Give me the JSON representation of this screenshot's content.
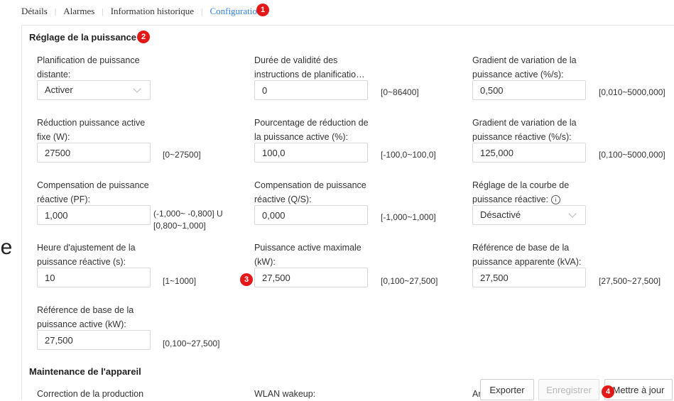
{
  "tabs": [
    "Détails",
    "Alarmes",
    "Information historique",
    "Configuration"
  ],
  "badges": [
    "1",
    "2",
    "3",
    "4"
  ],
  "left_clip_text": "le",
  "power_section": {
    "title": "Réglage de la puissance",
    "fields": [
      {
        "label": "Planification de puissance distante:",
        "value": "Activer",
        "type": "select",
        "range": ""
      },
      {
        "label": "Durée de validité des instructions de planificatio…",
        "value": "0",
        "type": "input",
        "range": "[0~86400]"
      },
      {
        "label": "Gradient de variation de la puissance active (%/s):",
        "value": "0,500",
        "type": "input",
        "range": "[0,010~5000,000]"
      },
      {
        "label": "Réduction puissance active fixe (W):",
        "value": "27500",
        "type": "input",
        "range": "[0~27500]"
      },
      {
        "label": "Pourcentage de réduction de la puissance active (%):",
        "value": "100,0",
        "type": "input",
        "range": "[-100,0~100,0]"
      },
      {
        "label": "Gradient de variation de la puissance réactive (%/s):",
        "value": "125,000",
        "type": "input",
        "range": "[0,100~5000,000]"
      },
      {
        "label": "Compensation de puissance réactive (PF):",
        "value": "1,000",
        "type": "input",
        "range": "(-1,000~ -0,800] U [0,800~1,000]"
      },
      {
        "label": "Compensation de puissance réactive (Q/S):",
        "value": "0,000",
        "type": "input",
        "range": "[-1,000~1,000]"
      },
      {
        "label": "Réglage de la courbe de puissance réactive:",
        "value": "Désactivé",
        "type": "select",
        "range": ""
      },
      {
        "label": "Heure d'ajustement de la puissance réactive (s):",
        "value": "10",
        "type": "input",
        "range": "[1~1000]"
      },
      {
        "label": "Puissance active maximale (kW):",
        "value": "27,500",
        "type": "input",
        "range": "[0,100~27,500]"
      },
      {
        "label": "Référence de base de la puissance apparente (kVA):",
        "value": "27,500",
        "type": "input",
        "range": "[27,500~27,500]"
      },
      {
        "label": "Référence de base de la puissance active (kW):",
        "value": "27,500",
        "type": "input",
        "range": "[0,100~27,500]"
      }
    ]
  },
  "maintenance_section": {
    "title": "Maintenance de l'appareil",
    "labels": [
      "Correction de la production",
      "WLAN wakeup:",
      "An"
    ]
  },
  "buttons": {
    "export": "Exporter",
    "save": "Enregistrer",
    "update": "Mettre à jour"
  },
  "colors": {
    "accent": "#2f80ed",
    "badge": "#e31818",
    "border": "#d9d9d9"
  }
}
